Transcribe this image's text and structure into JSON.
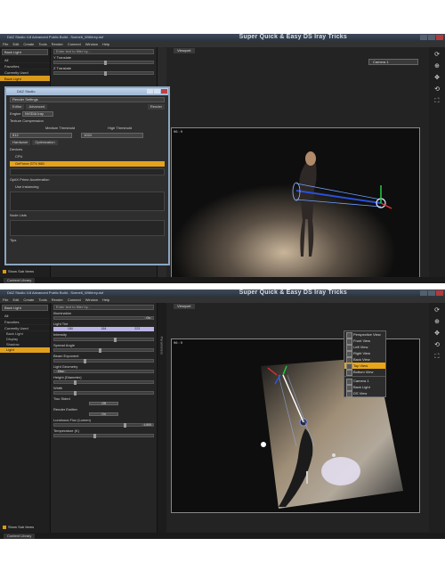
{
  "colors": {
    "accent": "#e9a619",
    "chrome": "#2a2a2a",
    "light_tint": "#b9b5e4"
  },
  "shot1": {
    "titlebar": "DAZ Studio 4.8 Advanced Public Build - Scene6_WithIrey.duf",
    "banner": "Super Quick & Easy DS Iray Tricks",
    "menu": [
      "File",
      "Edit",
      "Create",
      "Tools",
      "Render",
      "Connect",
      "Window",
      "Help"
    ],
    "left_panel": {
      "dropdown": "Back Light",
      "items": [
        "All",
        "Favorites",
        "Currently Used",
        "Back Light"
      ],
      "show_sub_items": "Show Sub Items"
    },
    "params": {
      "search_placeholder": "Enter text to filter by...",
      "rows": [
        {
          "label": "Y Translate",
          "value": ""
        },
        {
          "label": "Z Translate",
          "value": ""
        }
      ]
    },
    "dialog": {
      "title": "DAZ Studio",
      "subtitle": "Render Settings",
      "tabs": [
        "Editor",
        "Advanced"
      ],
      "render_label": "Render",
      "engine_label": "Engine",
      "engine_value": "NVIDIA Iray",
      "section": "Texture Compression",
      "thresholds": [
        "Medium Threshold",
        "High Threshold"
      ],
      "threshold_values": [
        "512",
        "1024"
      ],
      "subtabs": [
        "Hardware",
        "Optimization"
      ],
      "devices_label": "Devices",
      "devices": [
        "CPU",
        "GeForce GTX 980"
      ],
      "options": [
        "OptiX Prime Acceleration",
        "Use Instancing"
      ],
      "node_lists": "Node Lists",
      "tips": "Tips"
    },
    "viewport": {
      "tab": "Viewport",
      "camera": "Camera 1",
      "corner": "96 : 9"
    },
    "status_tab": "Content Library"
  },
  "shot2": {
    "titlebar": "DAZ Studio 4.8 Advanced Public Build - Scene6_WithIrey.duf",
    "banner": "Super Quick & Easy DS Iray Tricks",
    "menu": [
      "File",
      "Edit",
      "Create",
      "Tools",
      "Render",
      "Connect",
      "Window",
      "Help"
    ],
    "left_panel": {
      "dropdown": "Back Light",
      "items": [
        "All",
        "Favorites",
        "Currently Used"
      ],
      "tree": [
        "Back Light",
        "Display",
        "Shadow",
        "Light"
      ],
      "show_sub_items": "Show Sub Items"
    },
    "params": {
      "search_placeholder": "Enter text to filter by...",
      "rows": [
        {
          "label": "Illumination",
          "value": "On",
          "kind": "select"
        },
        {
          "label": "Light Tint",
          "kind": "color",
          "rgb": [
            "184",
            "184",
            "223"
          ]
        },
        {
          "label": "Intensity",
          "value": "",
          "kind": "slider"
        },
        {
          "label": "Spread Angle",
          "value": "",
          "kind": "slider"
        },
        {
          "label": "Beam Exponent",
          "value": "",
          "kind": "slider"
        },
        {
          "label": "Light Geometry",
          "value": "Disc",
          "kind": "select"
        },
        {
          "label": "Height (Diameter)",
          "value": "",
          "kind": "slider"
        },
        {
          "label": "Width",
          "value": "",
          "kind": "slider"
        },
        {
          "label": "Two Sided",
          "value": "Off",
          "kind": "button"
        },
        {
          "label": "Render Emitter",
          "value": "On",
          "kind": "button"
        },
        {
          "label": "Luminous Flux (Lumen)",
          "value": "1,500",
          "kind": "slider"
        },
        {
          "label": "Temperature (K)",
          "value": "",
          "kind": "slider"
        }
      ]
    },
    "side_tab": "Parameters",
    "viewport": {
      "tab": "Viewport",
      "corner": "96 : 9",
      "view_menu": [
        "Perspective View",
        "Front View",
        "Left View",
        "Right View",
        "Back View",
        "Top View",
        "Bottom View",
        "Camera 1",
        "Back Light",
        "DS View"
      ],
      "selected_view": "Top View"
    },
    "status_tab": "Content Library"
  }
}
